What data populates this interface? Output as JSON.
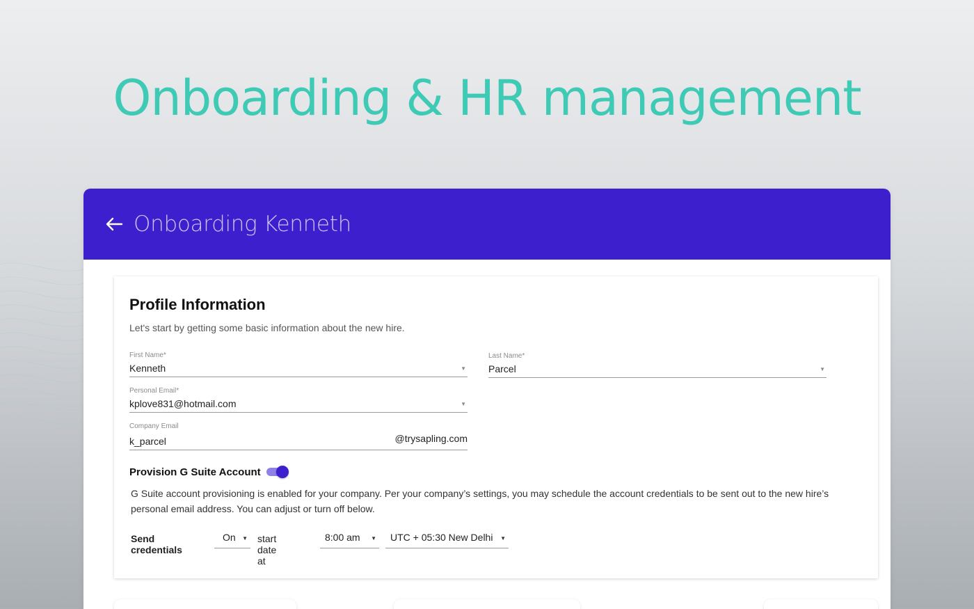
{
  "hero": {
    "title": "Onboarding & HR management"
  },
  "header": {
    "back_icon": "arrow-left-icon",
    "title": "Onboarding Kenneth",
    "background": "#3e1fcd"
  },
  "profile": {
    "title": "Profile Information",
    "subtitle": "Let's start by getting some basic information about the new hire.",
    "first_name": {
      "label": "First Name*",
      "value": "Kenneth"
    },
    "last_name": {
      "label": "Last Name*",
      "value": "Parcel"
    },
    "personal_email": {
      "label": "Personal Email*",
      "value": "kplove831@hotmail.com"
    },
    "company_email": {
      "label": "Company Email",
      "value": "k_parcel",
      "domain": "@trysapling.com"
    },
    "gsuite": {
      "label": "Provision G Suite Account",
      "toggle_on": true,
      "description": "G Suite account provisioning is enabled for your company. Per your company’s settings,  you may schedule the account credentials to be sent out to the new hire’s personal email address. You can adjust or turn off below."
    },
    "credentials": {
      "label": "Send credentials",
      "state": "On",
      "start_label": "start date at",
      "time": "8:00 am",
      "timezone": "UTC + 05:30 New Delhi"
    }
  },
  "colors": {
    "accent_teal": "#3ecab5",
    "brand_purple": "#3e1fcd"
  }
}
